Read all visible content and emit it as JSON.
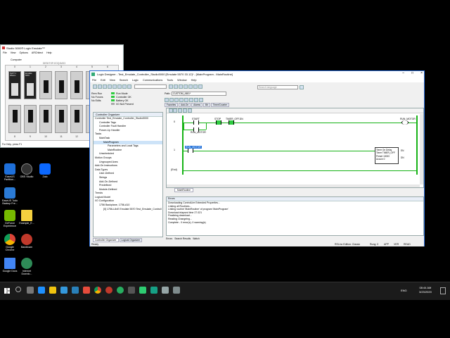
{
  "emulate": {
    "title": "Studio 5000® Logix Emulate™",
    "menu": [
      "File",
      "View",
      "Options",
      "ARChitect",
      "Help"
    ],
    "tab": "Computer",
    "chassis_name": "DESKTOP-EOQ1MG3",
    "slot_numbers_top": [
      "0",
      "1",
      "2",
      "3",
      "4",
      "5",
      "6"
    ],
    "slot_numbers_bottom": [
      "8",
      "9",
      "10",
      "11",
      "12",
      "13",
      "14"
    ],
    "module0_text": "SLOT 1 RSLinx",
    "module1_text": "Emulate 5570",
    "footer": "For Help, press F1"
  },
  "desktop": {
    "icons": [
      {
        "label": "AMD Ryzen\nMaster",
        "color": "#c0392b"
      },
      {
        "label": "Norton\nSecurity Scan",
        "color": "#f1c40f"
      },
      {
        "label": "WhatsApp",
        "color": "#25d366"
      },
      {
        "label": "EaseUS\nPartition...",
        "color": "#1e6fd9"
      },
      {
        "label": "OBS Studio",
        "color": "#333333"
      },
      {
        "label": "Zalo",
        "color": "#0b68ff"
      },
      {
        "label": "EaseUS Todo\nBackup Fre...",
        "color": "#2b7bd6"
      },
      {
        "label": "GeForce\nExperience",
        "color": "#76b900"
      },
      {
        "label": "Example_E...",
        "color": "#f4d03f"
      },
      {
        "label": "Google\nChrome",
        "color": "#db4437"
      },
      {
        "label": "Bandicam",
        "color": "#c0392b"
      },
      {
        "label": "Google Docs",
        "color": "#4285f4"
      },
      {
        "label": "Internet\nDownlo...",
        "color": "#2e8b57"
      }
    ]
  },
  "logix": {
    "title": "Logix Designer - Test_Emulate_Controller_Studio5000 [Emulate 5570 33.12]* - [MainProgram - MainRoutine]",
    "menu": [
      "File",
      "Edit",
      "View",
      "Search",
      "Logic",
      "Communications",
      "Tools",
      "Window",
      "Help"
    ],
    "search_placeholder": "Search language",
    "status_left": [
      "Rem Run",
      "No Forces",
      "No Edits"
    ],
    "status_right": [
      "Run Mode",
      "Controller OK",
      "Battery OK",
      "I/O Not Present"
    ],
    "path_label": "Path:",
    "path_value": "CUSTOM_AB\\1*",
    "ladder_tabs": [
      "Favorites",
      "Add-On",
      "Alarms",
      "Bit",
      "Timer/Counter"
    ],
    "organizer_title": "Controller Organizer",
    "tree": [
      "Controller Test_Emulate_Controller_Studio5000",
      "Controller Tags",
      "Controller Fault Handler",
      "Power-Up Handler",
      "Tasks",
      "MainTask",
      "MainProgram",
      "Parameters and Local Tags",
      "MainRoutine",
      "Unscheduled",
      "Motion Groups",
      "Ungrouped Axes",
      "Add-On Instructions",
      "Data Types",
      "User-Defined",
      "Strings",
      "Add-On-Defined",
      "Predefined",
      "Module-Defined",
      "Trends",
      "Logical Model",
      "I/O Configuration",
      "1756 Backplane, 1756-A10",
      "[0] 1756-L8xE Emulate 5570 Test_Emulate_Controll"
    ],
    "organizer_tabs": [
      "Controller Organizer",
      "Logical Organizer"
    ],
    "rungs": {
      "rung0_num": "0",
      "rung1_num": "1",
      "end_label": "(End)",
      "start": "START",
      "stop": "STOP",
      "timer_off_on": "TIMER_OFF.DN",
      "run_motor": "RUN_MOTOR",
      "run_motor_branch": "RUN_MOTOR",
      "timer_title": "Timer On Delay",
      "timer_name": "Timer",
      "timer_tag": "TIMER_OFF",
      "preset_label": "Preset",
      "preset_value": "10000",
      "accum_label": "Accum",
      "accum_value": "0",
      "en": "EN",
      "dn": "DN"
    },
    "routine_tab": "MainRoutine",
    "errors_title": "Errors",
    "errors_lines": [
      "Downloading ControlLire Extended Properties...",
      "Linking all Routines...",
      "Linking routine 'MainRoutine' of program 'MainProgram'",
      "Download elapsed time 27.021",
      "Finalizing download...",
      "Reading Changeing...",
      "Complete - 0 error(s), 0 warning(s)"
    ],
    "bottom_tabs": [
      "Errors",
      "Search Results",
      "Watch"
    ],
    "status_bar": [
      "Ready",
      "RSLinx Edition: Classic",
      "Rung: 0",
      "APP",
      "VER",
      "READ"
    ]
  },
  "taskbar": {
    "time": "08:44 AM",
    "date": "3/23/2020",
    "lang": "ENG"
  },
  "colors": {
    "title_bar": "#2a6ad3",
    "rail_green": "#17b317",
    "run_green": "#2ecc40"
  }
}
